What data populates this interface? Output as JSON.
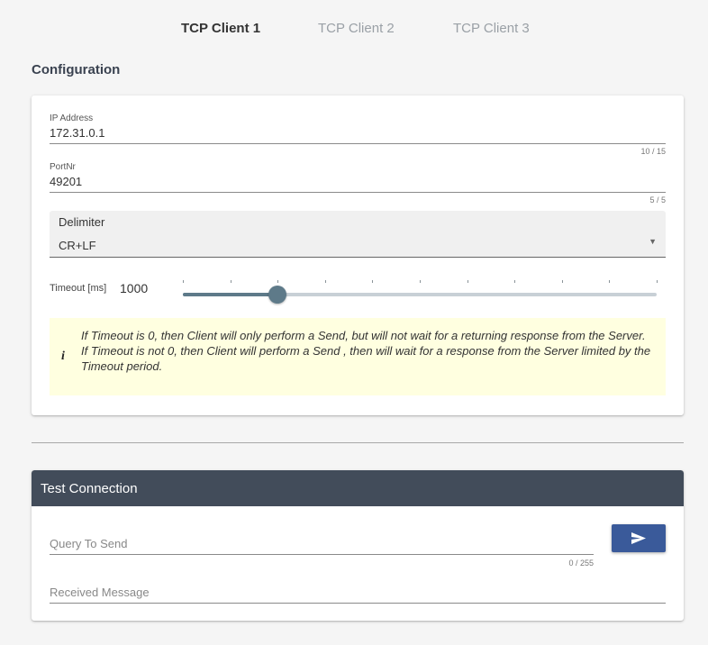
{
  "tabs": [
    {
      "label": "TCP Client 1",
      "active": true
    },
    {
      "label": "TCP Client 2",
      "active": false
    },
    {
      "label": "TCP Client 3",
      "active": false
    }
  ],
  "configuration": {
    "title": "Configuration",
    "ip_address": {
      "label": "IP Address",
      "value": "172.31.0.1",
      "counter": "10 / 15"
    },
    "port": {
      "label": "PortNr",
      "value": "49201",
      "counter": "5 / 5"
    },
    "delimiter": {
      "label": "Delimiter",
      "value": "CR+LF"
    },
    "timeout": {
      "label": "Timeout [ms]",
      "value": "1000",
      "slider_fraction": 0.2,
      "ticks": 11
    },
    "info": {
      "icon": "info-icon",
      "line1": "If Timeout is 0, then Client will only perform a Send, but will not wait for a returning response from the Server.",
      "line2": "If Timeout is not 0, then Client will perform a Send , then will wait for a response from the Server limited by the Timeout period."
    }
  },
  "test_connection": {
    "title": "Test Connection",
    "query": {
      "placeholder": "Query To Send",
      "counter": "0 / 255"
    },
    "received": {
      "placeholder": "Received Message"
    },
    "send_icon": "send-icon"
  },
  "colors": {
    "header_bg": "#424c5a",
    "send_button": "#3a5a9a",
    "slider": "#5e7a89",
    "info_bg": "#ffffe0"
  }
}
